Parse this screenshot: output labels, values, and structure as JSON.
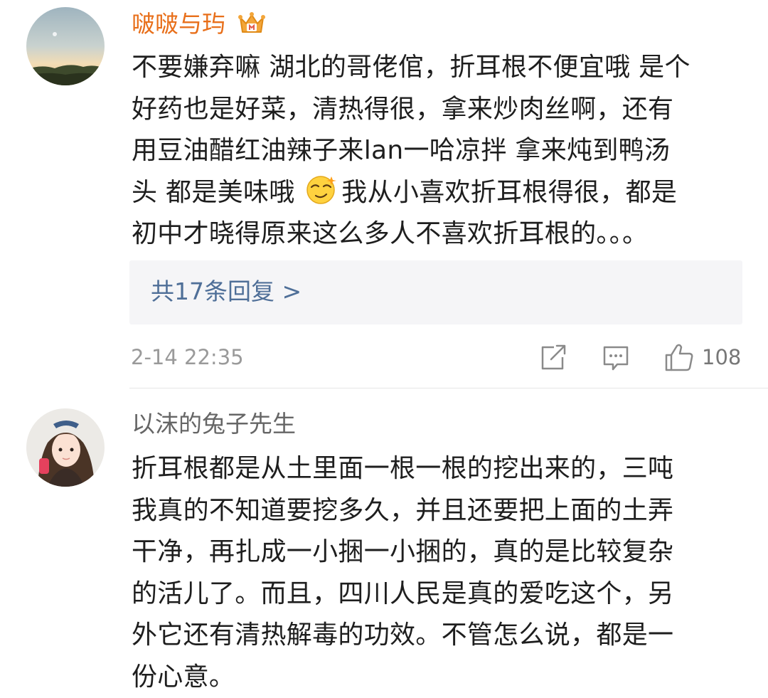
{
  "comments": [
    {
      "username": "啵啵与玙",
      "username_color": "#e86f1a",
      "badge_icon": "crown-vip-icon",
      "lines": [
        "不要嫌弃嘛 湖北的哥佬倌，折耳根不便宜哦 是个",
        "好药也是好菜，清热得很，拿来炒肉丝啊，还有",
        "用豆油醋红油辣子来lan一哈凉拌 拿来炖到鸭汤",
        "头 都是美味哦",
        "我从小喜欢折耳根得很，都是",
        "初中才晓得原来这么多人不喜欢折耳根的。。。"
      ],
      "emoji_icon": "smug-face-emoji-icon",
      "replies_label": "共17条回复 >",
      "timestamp": "2-14 22:35",
      "like_count": "108"
    },
    {
      "username": "以沫的兔子先生",
      "username_color": "#666666",
      "lines": [
        "折耳根都是从土里面一根一根的挖出来的，三吨",
        "我真的不知道要挖多久，并且还要把上面的土弄",
        "干净，再扎成一小捆一小捆的，真的是比较复杂",
        "的活儿了。而且，四川人民是真的爱吃这个，另",
        "外它还有清热解毒的功效。不管怎么说，都是一",
        "份心意。"
      ]
    }
  ]
}
